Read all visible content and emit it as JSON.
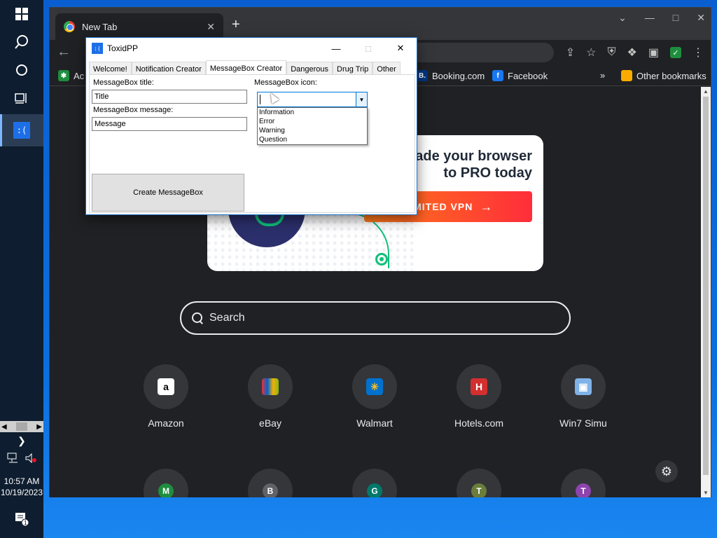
{
  "taskbar": {
    "clock_time": "10:57 AM",
    "clock_date": "10/19/2023",
    "app_icon_text": ":(",
    "notification_count": "1",
    "icons": [
      "windows-start-icon",
      "search-icon",
      "cortana-circle-icon",
      "task-view-icon"
    ]
  },
  "chrome": {
    "tab_title": "New Tab",
    "bookmarks": [
      {
        "label": "Ac",
        "icon": "green-bookmark-icon",
        "color": "#1e8e3e"
      },
      {
        "label": "Booking.com",
        "icon": "booking-icon",
        "color": "#003580"
      },
      {
        "label": "Facebook",
        "icon": "facebook-icon",
        "color": "#1877f2"
      },
      {
        "label": "Other bookmarks",
        "icon": "folder-icon",
        "color": "#f9ab00"
      }
    ],
    "overflow": "»"
  },
  "promo": {
    "line1": "ade your browser",
    "line2": "to PRO today",
    "button": "LIMITED VPN"
  },
  "search": {
    "placeholder": "Search"
  },
  "shortcuts": [
    {
      "label": "Amazon",
      "glyph": "a",
      "bg": "#ffffff",
      "fg": "#000000"
    },
    {
      "label": "eBay",
      "glyph": "🛍",
      "bg": "transparent",
      "fg": "#e53238"
    },
    {
      "label": "Walmart",
      "glyph": "✳",
      "bg": "#0071ce",
      "fg": "#ffc220"
    },
    {
      "label": "Hotels.com",
      "glyph": "H",
      "bg": "#d32f2f",
      "fg": "#ffffff"
    },
    {
      "label": "Win7 Simu",
      "glyph": "🖥",
      "bg": "transparent",
      "fg": "#4fa3ff"
    }
  ],
  "shortcuts_row2": [
    {
      "letter": "M",
      "color": "#1e8e3e"
    },
    {
      "letter": "B",
      "color": "#5f6368"
    },
    {
      "letter": "G",
      "color": "#00796b"
    },
    {
      "letter": "T",
      "color": "#6b7d3a"
    },
    {
      "letter": "T",
      "color": "#8e44ad"
    }
  ],
  "toxid": {
    "title": "ToxidPP",
    "icon_text": ":(",
    "tabs": [
      "Welcome!",
      "Notification Creator",
      "MessageBox Creator",
      "Dangerous",
      "Drug Trip",
      "Other"
    ],
    "active_tab": "MessageBox Creator",
    "title_label": "MessageBox title:",
    "title_value": "Title",
    "message_label": "MessageBox message:",
    "message_value": "Message",
    "icon_label": "MessageBox icon:",
    "icon_value": "",
    "icon_options": [
      "Information",
      "Error",
      "Warning",
      "Question"
    ],
    "create_button": "Create MessageBox"
  }
}
